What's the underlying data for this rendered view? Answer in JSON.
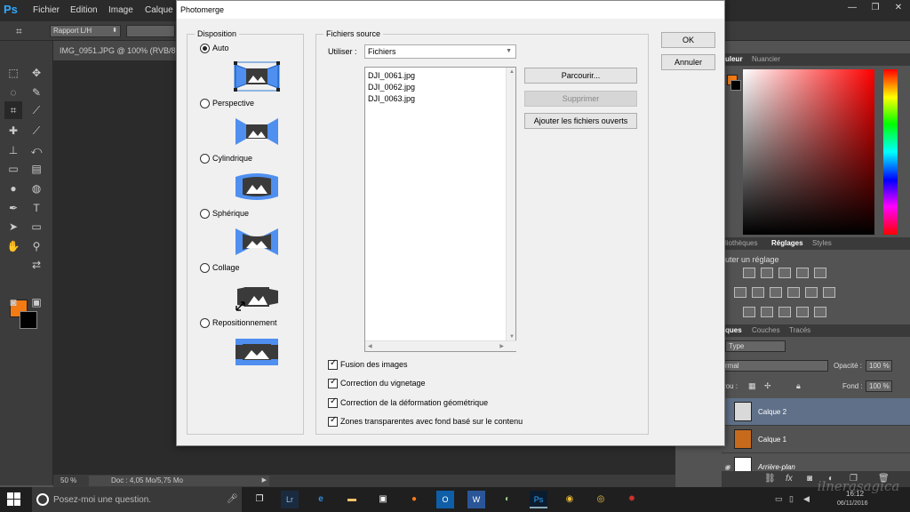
{
  "ps": {
    "logo": "Ps",
    "menus": [
      "Fichier",
      "Edition",
      "Image",
      "Calque"
    ],
    "window_controls": [
      "—",
      "❐",
      "✕"
    ],
    "options_ratio": "Rapport L/H",
    "doc_tab": "IMG_0951.JPG @ 100% (RVB/8)",
    "zoom": "50 %",
    "doc_size": "Doc : 4,05 Mo/5,75 Mo",
    "fg_color": "#f47a14",
    "bg_color": "#000000"
  },
  "panels": {
    "color_tabs": [
      "uleur",
      "Nuancier"
    ],
    "adj_tabs": [
      "liothèques",
      "Réglages",
      "Styles"
    ],
    "adj_title": "uter un réglage",
    "layers_tabs": [
      "ques",
      "Couches",
      "Tracés"
    ],
    "filter_type": "Type",
    "blend_mode": "rmal",
    "opacity_label": "Opacité :",
    "opacity_value": "100 %",
    "lock_label": "rou :",
    "fill_label": "Fond :",
    "fill_value": "100 %",
    "layers": [
      {
        "name": "Calque 2",
        "selected": true
      },
      {
        "name": "Calque 1",
        "selected": false
      },
      {
        "name": "Arrière-plan",
        "selected": false
      }
    ]
  },
  "taskbar": {
    "search_placeholder": "Posez-moi une question.",
    "time": "16:12",
    "date": "06/11/2016",
    "watermark": "ilnerasagica"
  },
  "dialog": {
    "title": "Photomerge",
    "disposition_legend": "Disposition",
    "layouts": [
      {
        "label": "Auto",
        "selected": true
      },
      {
        "label": "Perspective",
        "selected": false
      },
      {
        "label": "Cylindrique",
        "selected": false
      },
      {
        "label": "Sphérique",
        "selected": false
      },
      {
        "label": "Collage",
        "selected": false
      },
      {
        "label": "Repositionnement",
        "selected": false
      }
    ],
    "source_legend": "Fichiers source",
    "use_label": "Utiliser :",
    "use_value": "Fichiers",
    "files": [
      "DJI_0061.jpg",
      "DJI_0062.jpg",
      "DJI_0063.jpg"
    ],
    "buttons": {
      "ok": "OK",
      "cancel": "Annuler",
      "browse": "Parcourir...",
      "remove": "Supprimer",
      "add_open": "Ajouter les fichiers ouverts"
    },
    "options": [
      {
        "label": "Fusion des images",
        "checked": true
      },
      {
        "label": "Correction du vignetage",
        "checked": true
      },
      {
        "label": "Correction de la déformation géométrique",
        "checked": true
      },
      {
        "label": "Zones transparentes avec fond basé sur le contenu",
        "checked": true
      }
    ]
  }
}
